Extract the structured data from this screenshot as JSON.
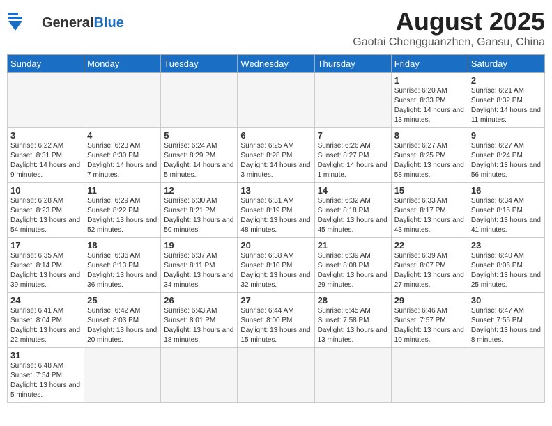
{
  "header": {
    "logo_general": "General",
    "logo_blue": "Blue",
    "month_year": "August 2025",
    "location": "Gaotai Chengguanzhen, Gansu, China"
  },
  "weekdays": [
    "Sunday",
    "Monday",
    "Tuesday",
    "Wednesday",
    "Thursday",
    "Friday",
    "Saturday"
  ],
  "weeks": [
    [
      {
        "day": "",
        "info": ""
      },
      {
        "day": "",
        "info": ""
      },
      {
        "day": "",
        "info": ""
      },
      {
        "day": "",
        "info": ""
      },
      {
        "day": "",
        "info": ""
      },
      {
        "day": "1",
        "info": "Sunrise: 6:20 AM\nSunset: 8:33 PM\nDaylight: 14 hours and 13 minutes."
      },
      {
        "day": "2",
        "info": "Sunrise: 6:21 AM\nSunset: 8:32 PM\nDaylight: 14 hours and 11 minutes."
      }
    ],
    [
      {
        "day": "3",
        "info": "Sunrise: 6:22 AM\nSunset: 8:31 PM\nDaylight: 14 hours and 9 minutes."
      },
      {
        "day": "4",
        "info": "Sunrise: 6:23 AM\nSunset: 8:30 PM\nDaylight: 14 hours and 7 minutes."
      },
      {
        "day": "5",
        "info": "Sunrise: 6:24 AM\nSunset: 8:29 PM\nDaylight: 14 hours and 5 minutes."
      },
      {
        "day": "6",
        "info": "Sunrise: 6:25 AM\nSunset: 8:28 PM\nDaylight: 14 hours and 3 minutes."
      },
      {
        "day": "7",
        "info": "Sunrise: 6:26 AM\nSunset: 8:27 PM\nDaylight: 14 hours and 1 minute."
      },
      {
        "day": "8",
        "info": "Sunrise: 6:27 AM\nSunset: 8:25 PM\nDaylight: 13 hours and 58 minutes."
      },
      {
        "day": "9",
        "info": "Sunrise: 6:27 AM\nSunset: 8:24 PM\nDaylight: 13 hours and 56 minutes."
      }
    ],
    [
      {
        "day": "10",
        "info": "Sunrise: 6:28 AM\nSunset: 8:23 PM\nDaylight: 13 hours and 54 minutes."
      },
      {
        "day": "11",
        "info": "Sunrise: 6:29 AM\nSunset: 8:22 PM\nDaylight: 13 hours and 52 minutes."
      },
      {
        "day": "12",
        "info": "Sunrise: 6:30 AM\nSunset: 8:21 PM\nDaylight: 13 hours and 50 minutes."
      },
      {
        "day": "13",
        "info": "Sunrise: 6:31 AM\nSunset: 8:19 PM\nDaylight: 13 hours and 48 minutes."
      },
      {
        "day": "14",
        "info": "Sunrise: 6:32 AM\nSunset: 8:18 PM\nDaylight: 13 hours and 45 minutes."
      },
      {
        "day": "15",
        "info": "Sunrise: 6:33 AM\nSunset: 8:17 PM\nDaylight: 13 hours and 43 minutes."
      },
      {
        "day": "16",
        "info": "Sunrise: 6:34 AM\nSunset: 8:15 PM\nDaylight: 13 hours and 41 minutes."
      }
    ],
    [
      {
        "day": "17",
        "info": "Sunrise: 6:35 AM\nSunset: 8:14 PM\nDaylight: 13 hours and 39 minutes."
      },
      {
        "day": "18",
        "info": "Sunrise: 6:36 AM\nSunset: 8:13 PM\nDaylight: 13 hours and 36 minutes."
      },
      {
        "day": "19",
        "info": "Sunrise: 6:37 AM\nSunset: 8:11 PM\nDaylight: 13 hours and 34 minutes."
      },
      {
        "day": "20",
        "info": "Sunrise: 6:38 AM\nSunset: 8:10 PM\nDaylight: 13 hours and 32 minutes."
      },
      {
        "day": "21",
        "info": "Sunrise: 6:39 AM\nSunset: 8:08 PM\nDaylight: 13 hours and 29 minutes."
      },
      {
        "day": "22",
        "info": "Sunrise: 6:39 AM\nSunset: 8:07 PM\nDaylight: 13 hours and 27 minutes."
      },
      {
        "day": "23",
        "info": "Sunrise: 6:40 AM\nSunset: 8:06 PM\nDaylight: 13 hours and 25 minutes."
      }
    ],
    [
      {
        "day": "24",
        "info": "Sunrise: 6:41 AM\nSunset: 8:04 PM\nDaylight: 13 hours and 22 minutes."
      },
      {
        "day": "25",
        "info": "Sunrise: 6:42 AM\nSunset: 8:03 PM\nDaylight: 13 hours and 20 minutes."
      },
      {
        "day": "26",
        "info": "Sunrise: 6:43 AM\nSunset: 8:01 PM\nDaylight: 13 hours and 18 minutes."
      },
      {
        "day": "27",
        "info": "Sunrise: 6:44 AM\nSunset: 8:00 PM\nDaylight: 13 hours and 15 minutes."
      },
      {
        "day": "28",
        "info": "Sunrise: 6:45 AM\nSunset: 7:58 PM\nDaylight: 13 hours and 13 minutes."
      },
      {
        "day": "29",
        "info": "Sunrise: 6:46 AM\nSunset: 7:57 PM\nDaylight: 13 hours and 10 minutes."
      },
      {
        "day": "30",
        "info": "Sunrise: 6:47 AM\nSunset: 7:55 PM\nDaylight: 13 hours and 8 minutes."
      }
    ],
    [
      {
        "day": "31",
        "info": "Sunrise: 6:48 AM\nSunset: 7:54 PM\nDaylight: 13 hours and 5 minutes."
      },
      {
        "day": "",
        "info": ""
      },
      {
        "day": "",
        "info": ""
      },
      {
        "day": "",
        "info": ""
      },
      {
        "day": "",
        "info": ""
      },
      {
        "day": "",
        "info": ""
      },
      {
        "day": "",
        "info": ""
      }
    ]
  ]
}
